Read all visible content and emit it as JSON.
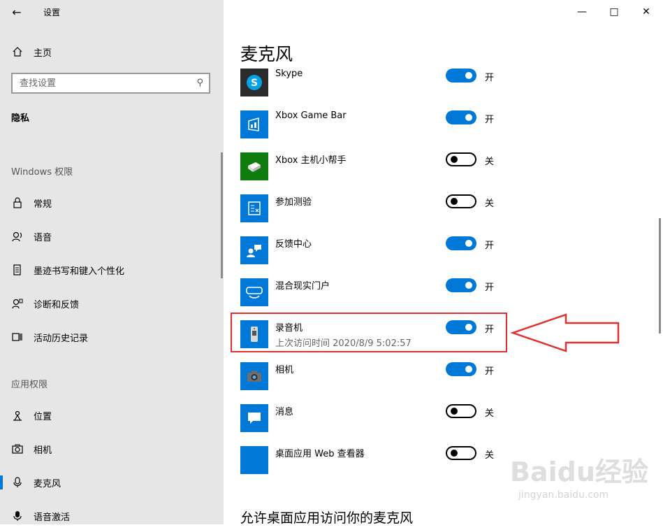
{
  "window": {
    "title": "设置"
  },
  "sidebar": {
    "home_label": "主页",
    "search_placeholder": "查找设置",
    "section": "隐私",
    "group_windows": "Windows 权限",
    "windows_items": [
      {
        "label": "常规",
        "icon": "lock-icon"
      },
      {
        "label": "语音",
        "icon": "speech-icon"
      },
      {
        "label": "墨迹书写和键入个性化",
        "icon": "inking-icon"
      },
      {
        "label": "诊断和反馈",
        "icon": "diagnostics-icon"
      },
      {
        "label": "活动历史记录",
        "icon": "activity-history-icon"
      }
    ],
    "group_apps": "应用权限",
    "app_items": [
      {
        "label": "位置",
        "icon": "location-icon"
      },
      {
        "label": "相机",
        "icon": "camera-icon"
      },
      {
        "label": "麦克风",
        "icon": "microphone-icon",
        "selected": true
      },
      {
        "label": "语音激活",
        "icon": "voice-activation-icon"
      }
    ]
  },
  "main": {
    "title": "麦克风",
    "apps": [
      {
        "name": "Skype",
        "state": "开",
        "on": true
      },
      {
        "name": "Xbox Game Bar",
        "state": "开",
        "on": true
      },
      {
        "name": "Xbox 主机小帮手",
        "state": "关",
        "on": false
      },
      {
        "name": "参加测验",
        "state": "关",
        "on": false
      },
      {
        "name": "反馈中心",
        "state": "开",
        "on": true
      },
      {
        "name": "混合现实门户",
        "state": "开",
        "on": true
      },
      {
        "name": "录音机",
        "sub": "上次访问时间 2020/8/9 5:02:57",
        "state": "开",
        "on": true
      },
      {
        "name": "相机",
        "state": "开",
        "on": true
      },
      {
        "name": "消息",
        "state": "关",
        "on": false
      },
      {
        "name": "桌面应用 Web 查看器",
        "state": "关",
        "on": false
      }
    ],
    "footer_heading": "允许桌面应用访问你的麦克风"
  },
  "watermark": {
    "logo": "Baidu经验",
    "url": "jingyan.baidu.com"
  },
  "colors": {
    "accent": "#0078d7",
    "highlight": "#e03030",
    "sidebar_bg": "#e6e6e6"
  }
}
